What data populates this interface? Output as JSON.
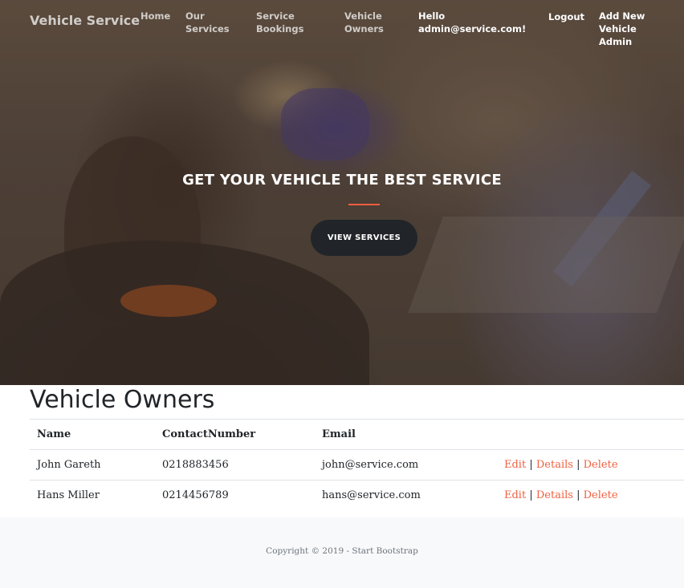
{
  "nav": {
    "brand": "Vehicle Service",
    "home": "Home",
    "our_services_1": "Our",
    "our_services_2": "Services",
    "service_bookings_1": "Service",
    "service_bookings_2": "Bookings",
    "vehicle_owners_1": "Vehicle",
    "vehicle_owners_2": "Owners",
    "hello_1": "Hello",
    "hello_2": "admin@service.com!",
    "logout": "Logout",
    "add_new_1": "Add New Vehicle",
    "add_new_2": "Admin"
  },
  "hero": {
    "title": "GET YOUR VEHICLE THE BEST SERVICE",
    "button": "VIEW SERVICES",
    "accent_color": "#f05f40"
  },
  "main": {
    "title": "Vehicle Owners",
    "columns": [
      "Name",
      "ContactNumber",
      "Email",
      ""
    ],
    "rows": [
      {
        "name": "John Gareth",
        "contact": "0218883456",
        "email": "john@service.com"
      },
      {
        "name": "Hans Miller",
        "contact": "0214456789",
        "email": "hans@service.com"
      }
    ],
    "actions": {
      "edit": "Edit",
      "details": "Details",
      "delete": "Delete",
      "separator": "|"
    }
  },
  "footer": {
    "copyright": "Copyright © 2019 - Start Bootstrap"
  }
}
